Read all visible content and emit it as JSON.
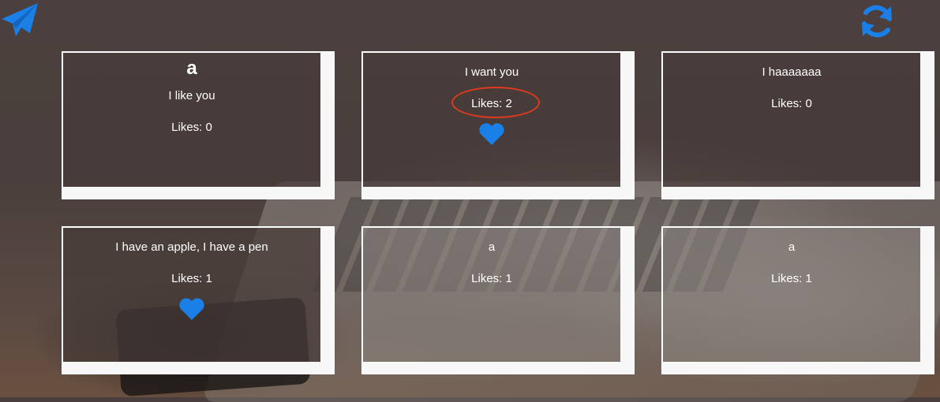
{
  "toolbar": {
    "send_icon": "paper-plane-icon",
    "refresh_icon": "refresh-icon",
    "accent": "#1a7fe6"
  },
  "cards": [
    {
      "title": "a",
      "message": "I like you",
      "likes": "Likes: 0",
      "liked": false
    },
    {
      "title": "",
      "message": "I want you",
      "likes": "Likes: 2",
      "liked": true,
      "highlighted": true
    },
    {
      "title": "",
      "message": "I haaaaaaa",
      "likes": "Likes: 0",
      "liked": false
    },
    {
      "title": "",
      "message": "I have an apple, I have a pen",
      "likes": "Likes: 1",
      "liked": true
    },
    {
      "title": "",
      "message": "a",
      "likes": "Likes: 1",
      "liked": false
    },
    {
      "title": "",
      "message": "a",
      "likes": "Likes: 1",
      "liked": false
    }
  ],
  "annotation": {
    "color": "#e03a1e"
  }
}
